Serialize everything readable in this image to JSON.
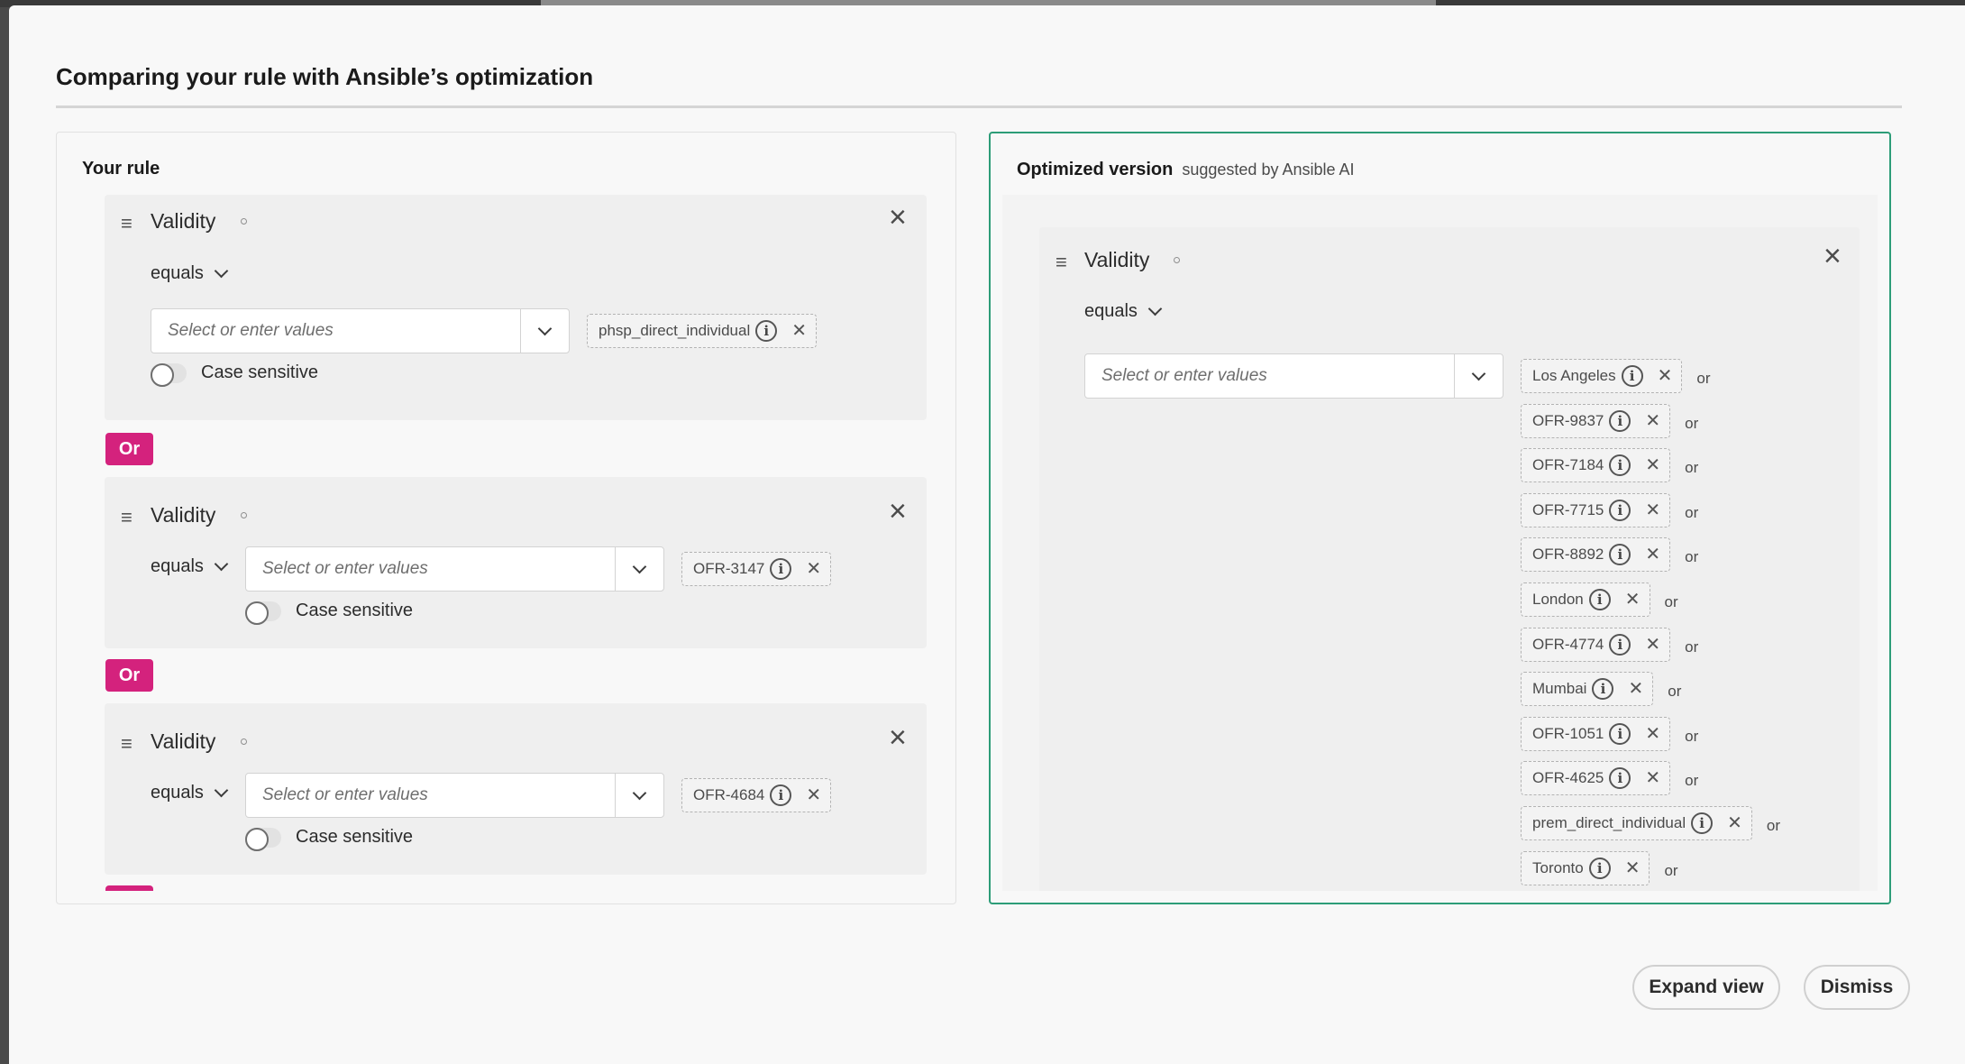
{
  "modal": {
    "title": "Comparing your rule with Ansible’s optimization"
  },
  "your_rule": {
    "label": "Your rule",
    "or_label": "Or",
    "conditions": [
      {
        "field": "Validity",
        "operator": "equals",
        "placeholder": "Select or enter values",
        "tag": "phsp_direct_individual",
        "case_sensitive_label": "Case sensitive"
      },
      {
        "field": "Validity",
        "operator": "equals",
        "placeholder": "Select or enter values",
        "tag": "OFR-3147",
        "case_sensitive_label": "Case sensitive"
      },
      {
        "field": "Validity",
        "operator": "equals",
        "placeholder": "Select or enter values",
        "tag": "OFR-4684",
        "case_sensitive_label": "Case sensitive"
      }
    ]
  },
  "optimized": {
    "label": "Optimized version",
    "sublabel": "suggested by Ansible AI",
    "field": "Validity",
    "operator": "equals",
    "placeholder": "Select or enter values",
    "or_word": "or",
    "tags": [
      "Los Angeles",
      "OFR-9837",
      "OFR-7184",
      "OFR-7715",
      "OFR-8892",
      "London",
      "OFR-4774",
      "Mumbai",
      "OFR-1051",
      "OFR-4625",
      "prem_direct_individual",
      "Toronto"
    ]
  },
  "footer": {
    "expand_label": "Expand view",
    "dismiss_label": "Dismiss"
  }
}
